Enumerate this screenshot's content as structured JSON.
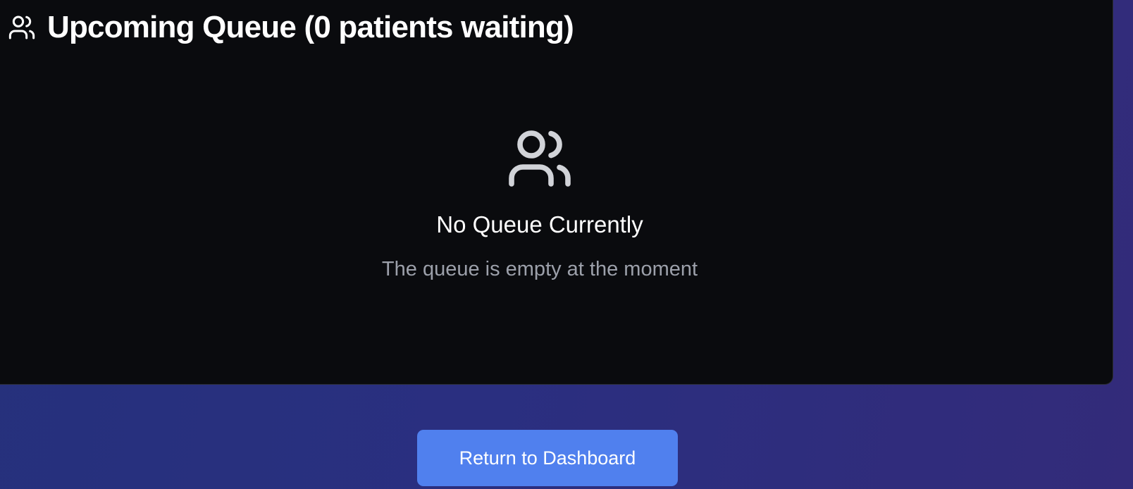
{
  "queue": {
    "title": "Upcoming Queue (0 patients waiting)",
    "header_icon": "users-icon"
  },
  "empty_state": {
    "icon": "users-icon",
    "title": "No Queue Currently",
    "subtitle": "The queue is empty at the moment"
  },
  "actions": {
    "return_label": "Return to Dashboard"
  },
  "colors": {
    "card_background": "#0a0b0e",
    "page_gradient_start": "#25317c",
    "page_gradient_end": "#332b7a",
    "button_accent": "#5080ee",
    "muted_text": "#9ca0aa",
    "empty_icon": "#d1d3d8"
  }
}
